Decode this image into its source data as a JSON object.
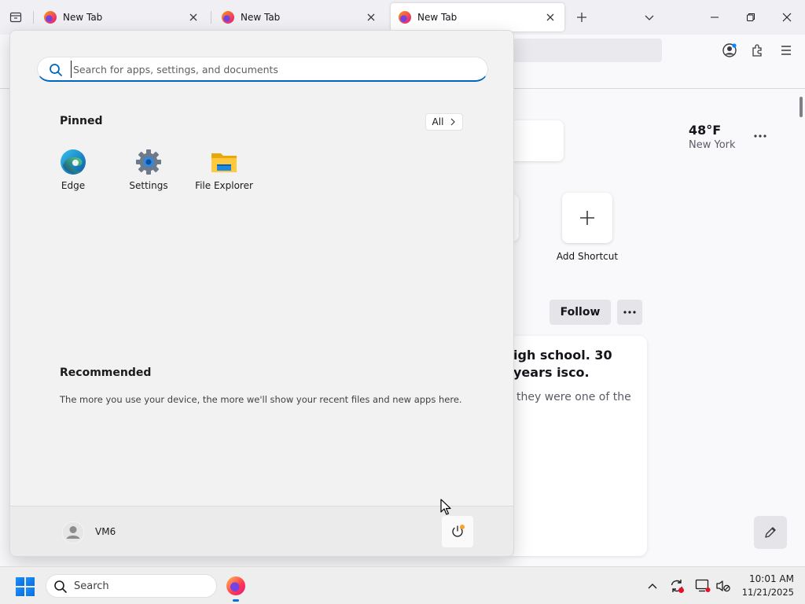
{
  "browser": {
    "tabs": [
      {
        "title": "New Tab",
        "active": false
      },
      {
        "title": "New Tab",
        "active": false
      },
      {
        "title": "New Tab",
        "active": true
      }
    ],
    "new_tab_icon": "plus-icon",
    "list_tabs_icon": "chevron-down-icon"
  },
  "newtab_page": {
    "weather": {
      "temperature": "48°F",
      "city": "New York"
    },
    "add_shortcut_label": "Add Shortcut",
    "follow_label": "Follow",
    "story": {
      "title": "igh school. 30 years isco.",
      "snippet": "they were one of the"
    }
  },
  "start_menu": {
    "search": {
      "placeholder": "Search for apps, settings, and documents",
      "value": ""
    },
    "pinned_title": "Pinned",
    "all_button": "All",
    "pinned_apps": [
      {
        "label": "Edge",
        "icon": "edge-icon"
      },
      {
        "label": "Settings",
        "icon": "settings-gear-icon"
      },
      {
        "label": "File Explorer",
        "icon": "folder-icon"
      }
    ],
    "recommended_title": "Recommended",
    "recommended_text": "The more you use your device, the more we'll show your recent files and new apps here.",
    "user_name": "VM6"
  },
  "taskbar": {
    "search_label": "Search",
    "time": "10:01 AM",
    "date": "11/21/2025"
  },
  "colors": {
    "accent": "#0067c0",
    "windows_blue": "#1e90ff",
    "update_dot": "#f7a428",
    "tray_alert": "#e81123"
  }
}
